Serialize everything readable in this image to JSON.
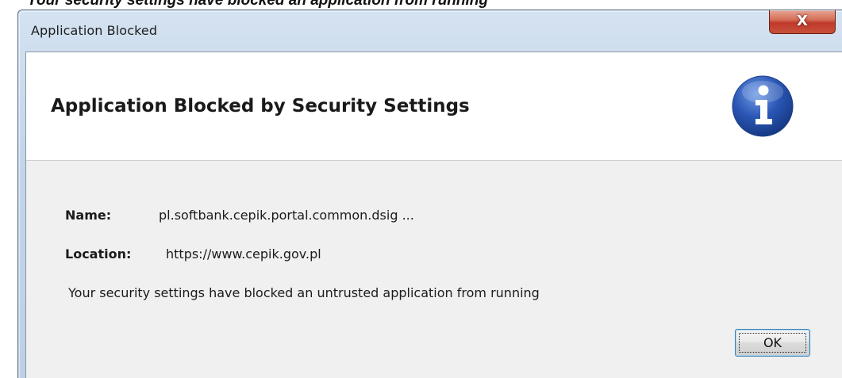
{
  "page_caption": "Your security settings have blocked an application from running",
  "window": {
    "title": "Application Blocked",
    "close_label": "X"
  },
  "header": {
    "title": "Application Blocked by Security Settings",
    "icon": "info-icon",
    "icon_color": "#2a56b4"
  },
  "details": {
    "name_label": "Name:",
    "name_value": "pl.softbank.cepik.portal.common.dsig ...",
    "location_label": "Location:",
    "location_value": "https://www.cepik.gov.pl"
  },
  "message": "Your security settings have blocked an untrusted application from running",
  "buttons": {
    "ok_label": "OK"
  }
}
